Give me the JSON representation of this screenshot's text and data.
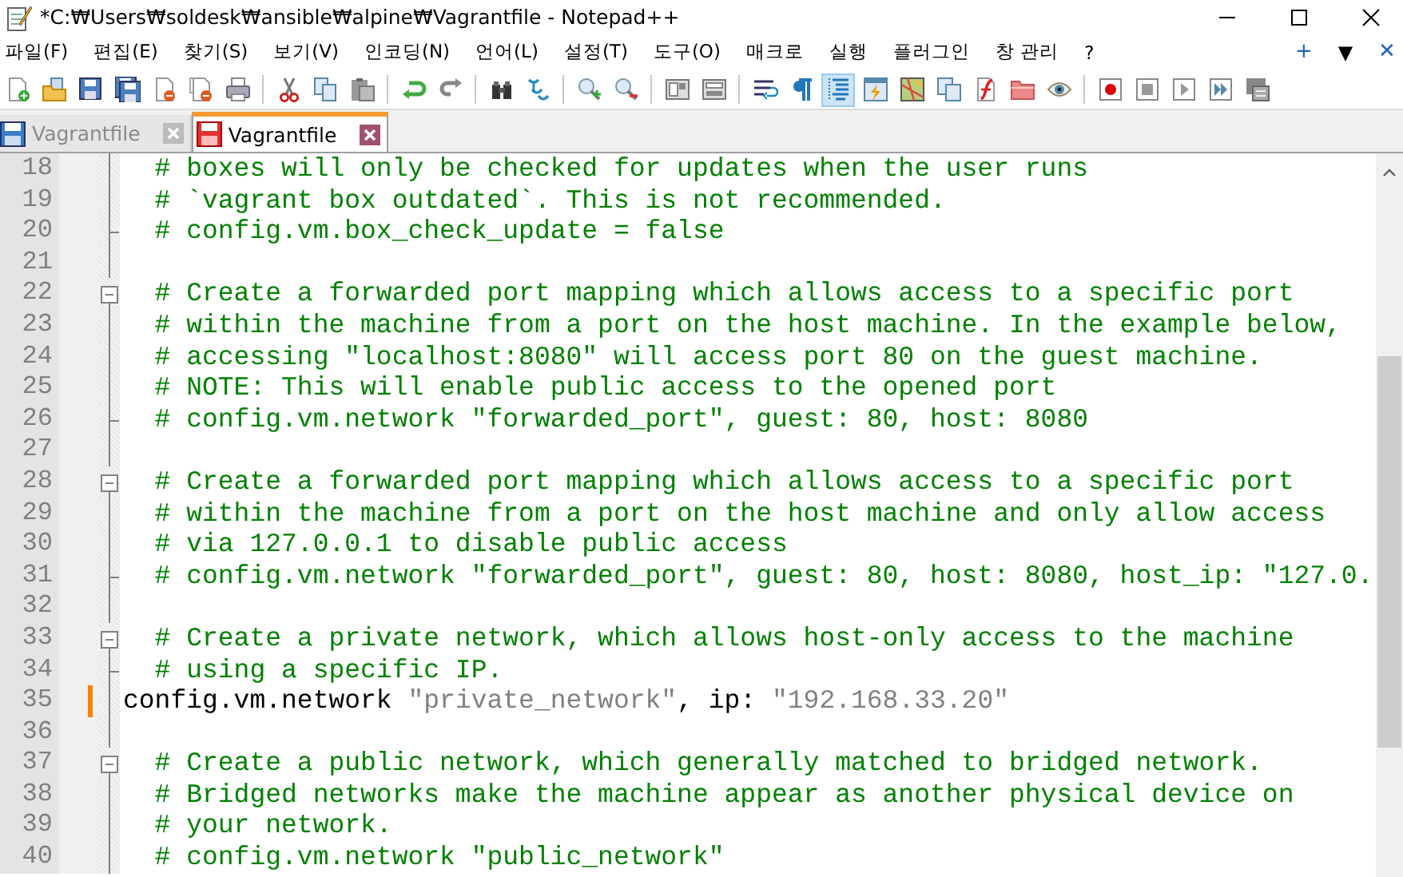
{
  "window": {
    "title": "*C:₩Users₩soldesk₩ansible₩alpine₩Vagrantfile - Notepad++"
  },
  "menu_bar": {
    "items": [
      "파일(F)",
      "편집(E)",
      "찾기(S)",
      "보기(V)",
      "인코딩(N)",
      "언어(L)",
      "설정(T)",
      "도구(O)",
      "매크로",
      "실행",
      "플러그인",
      "창 관리",
      "?"
    ],
    "controls": [
      "+",
      "▼",
      "✕"
    ]
  },
  "toolbar": [
    [
      {
        "kind": "new",
        "pressed": false
      },
      {
        "kind": "open",
        "pressed": false
      },
      {
        "kind": "save",
        "pressed": false
      },
      {
        "kind": "save-all",
        "pressed": false
      },
      {
        "kind": "close",
        "pressed": false
      },
      {
        "kind": "close-all",
        "pressed": false
      },
      {
        "kind": "print",
        "pressed": false
      }
    ],
    [
      {
        "kind": "cut",
        "pressed": false
      },
      {
        "kind": "copy",
        "pressed": false
      },
      {
        "kind": "paste",
        "pressed": false
      }
    ],
    [
      {
        "kind": "undo",
        "pressed": false
      },
      {
        "kind": "redo",
        "pressed": false
      }
    ],
    [
      {
        "kind": "find",
        "pressed": false
      },
      {
        "kind": "replace",
        "pressed": false
      }
    ],
    [
      {
        "kind": "zoom-in",
        "pressed": false
      },
      {
        "kind": "zoom-out",
        "pressed": false
      }
    ],
    [
      {
        "kind": "sync-v",
        "pressed": false
      },
      {
        "kind": "sync-h",
        "pressed": false
      }
    ],
    [
      {
        "kind": "wrap",
        "pressed": false
      },
      {
        "kind": "all-chars",
        "pressed": false
      },
      {
        "kind": "indent-guide",
        "pressed": true
      },
      {
        "kind": "udl",
        "pressed": false
      },
      {
        "kind": "doc-map",
        "pressed": false
      },
      {
        "kind": "doc-list",
        "pressed": false
      },
      {
        "kind": "function-list",
        "pressed": false
      },
      {
        "kind": "folder",
        "pressed": false
      },
      {
        "kind": "monitor",
        "pressed": false
      }
    ],
    [
      {
        "kind": "record",
        "pressed": false
      },
      {
        "kind": "stop",
        "pressed": false
      },
      {
        "kind": "play",
        "pressed": false
      },
      {
        "kind": "play-multi",
        "pressed": false
      },
      {
        "kind": "save-macro",
        "pressed": false
      }
    ]
  ],
  "tabs": [
    {
      "label": "Vagrantfile",
      "selected": false,
      "modified": false
    },
    {
      "label": "Vagrantfile",
      "selected": true,
      "modified": true
    }
  ],
  "editor": {
    "lines": [
      {
        "number": "18",
        "kind": "body",
        "changed": false,
        "tokens": [
          {
            "kind": "comment",
            "text": "  # boxes will only be checked for updates when the user runs"
          }
        ]
      },
      {
        "number": "19",
        "kind": "body",
        "changed": false,
        "tokens": [
          {
            "kind": "comment",
            "text": "  # `vagrant box outdated`. This is not recommended."
          }
        ]
      },
      {
        "number": "20",
        "kind": "end",
        "changed": false,
        "tokens": [
          {
            "kind": "comment",
            "text": "  # config.vm.box_check_update = false"
          }
        ]
      },
      {
        "number": "21",
        "kind": "body",
        "changed": false
      },
      {
        "number": "22",
        "kind": "start",
        "changed": false,
        "tokens": [
          {
            "kind": "comment",
            "text": "  # Create a forwarded port mapping which allows access to a specific port"
          }
        ]
      },
      {
        "number": "23",
        "kind": "body",
        "changed": false,
        "tokens": [
          {
            "kind": "comment",
            "text": "  # within the machine from a port on the host machine. In the example below,"
          }
        ]
      },
      {
        "number": "24",
        "kind": "body",
        "changed": false,
        "tokens": [
          {
            "kind": "comment",
            "text": "  # accessing \"localhost:8080\" will access port 80 on the guest machine."
          }
        ]
      },
      {
        "number": "25",
        "kind": "body",
        "changed": false,
        "tokens": [
          {
            "kind": "comment",
            "text": "  # NOTE: This will enable public access to the opened port"
          }
        ]
      },
      {
        "number": "26",
        "kind": "end",
        "changed": false,
        "tokens": [
          {
            "kind": "comment",
            "text": "  # config.vm.network \"forwarded_port\", guest: 80, host: 8080"
          }
        ]
      },
      {
        "number": "27",
        "kind": "body",
        "changed": false
      },
      {
        "number": "28",
        "kind": "start",
        "changed": false,
        "tokens": [
          {
            "kind": "comment",
            "text": "  # Create a forwarded port mapping which allows access to a specific port"
          }
        ]
      },
      {
        "number": "29",
        "kind": "body",
        "changed": false,
        "tokens": [
          {
            "kind": "comment",
            "text": "  # within the machine from a port on the host machine and only allow access"
          }
        ]
      },
      {
        "number": "30",
        "kind": "body",
        "changed": false,
        "tokens": [
          {
            "kind": "comment",
            "text": "  # via 127.0.0.1 to disable public access"
          }
        ]
      },
      {
        "number": "31",
        "kind": "end",
        "changed": false,
        "tokens": [
          {
            "kind": "comment",
            "text": "  # config.vm.network \"forwarded_port\", guest: 80, host: 8080, host_ip: \"127.0."
          }
        ]
      },
      {
        "number": "32",
        "kind": "body",
        "changed": false
      },
      {
        "number": "33",
        "kind": "start",
        "changed": false,
        "tokens": [
          {
            "kind": "comment",
            "text": "  # Create a private network, which allows host-only access to the machine"
          }
        ]
      },
      {
        "number": "34",
        "kind": "end",
        "changed": false,
        "tokens": [
          {
            "kind": "comment",
            "text": "  # using a specific IP."
          }
        ]
      },
      {
        "number": "35",
        "kind": "body",
        "changed": true,
        "tokens": [
          {
            "kind": "code",
            "text": "config.vm.network "
          },
          {
            "kind": "string",
            "text": "\"private_network\""
          },
          {
            "kind": "code",
            "text": ", ip: "
          },
          {
            "kind": "string",
            "text": "\"192.168.33.20\""
          }
        ]
      },
      {
        "number": "36",
        "kind": "body",
        "changed": false
      },
      {
        "number": "37",
        "kind": "start",
        "changed": false,
        "tokens": [
          {
            "kind": "comment",
            "text": "  # Create a public network, which generally matched to bridged network."
          }
        ]
      },
      {
        "number": "38",
        "kind": "body",
        "changed": false,
        "tokens": [
          {
            "kind": "comment",
            "text": "  # Bridged networks make the machine appear as another physical device on"
          }
        ]
      },
      {
        "number": "39",
        "kind": "body",
        "changed": false,
        "tokens": [
          {
            "kind": "comment",
            "text": "  # your network."
          }
        ]
      },
      {
        "number": "40",
        "kind": "body",
        "changed": false,
        "tokens": [
          {
            "kind": "comment",
            "text": "  # config.vm.network \"public_network\""
          }
        ]
      }
    ]
  }
}
